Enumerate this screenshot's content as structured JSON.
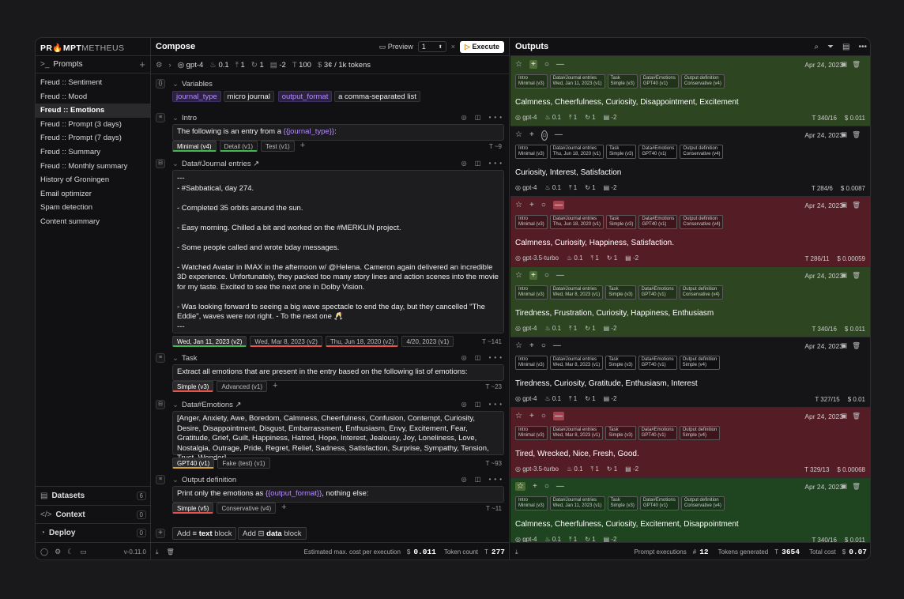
{
  "app": {
    "logo_bold": "PR🔥MPT",
    "logo_rest": "METHEUS",
    "version": "v-0.11.0"
  },
  "sidebar": {
    "header": "Prompts",
    "items": [
      "Freud :: Sentiment",
      "Freud :: Mood",
      "Freud :: Emotions",
      "Freud :: Prompt (3 days)",
      "Freud :: Prompt (7 days)",
      "Freud :: Summary",
      "Freud :: Monthly summary",
      "History of Groningen",
      "Email optimizer",
      "Spam detection",
      "Content summary"
    ],
    "active": "Freud :: Emotions",
    "sections": [
      {
        "label": "Datasets",
        "count": "6"
      },
      {
        "label": "Context",
        "count": "0"
      },
      {
        "label": "Deploy",
        "count": "0"
      }
    ]
  },
  "compose": {
    "title": "Compose",
    "preview": "Preview",
    "runs": "1",
    "execute": "Execute",
    "model": {
      "name": "gpt-4",
      "temperature": "0.1",
      "top_p": "1",
      "freq": "1",
      "presence": "-2",
      "max_tokens": "100",
      "cost": "3¢ / 1k tokens"
    },
    "variables_label": "Variables",
    "variables": [
      {
        "key": "journal_type",
        "value": "micro journal"
      },
      {
        "key": "output_format",
        "value": "a comma-separated list"
      }
    ],
    "intro": {
      "title": "Intro",
      "text_pre": "The following is an entry from a ",
      "var": "{{journal_type}}",
      "text_post": ":",
      "tabs": [
        "Minimal (v4)",
        "Detail (v1)",
        "Test (v1)"
      ],
      "tokens": "~9"
    },
    "journal": {
      "title": "Data#Journal entries",
      "lines": [
        "---",
        "- #Sabbatical, day 274.",
        "",
        "- Completed 35 orbits around the sun.",
        "",
        "- Easy morning. Chilled a bit and worked on the #MERKLIN project.",
        "",
        "- Some people called and wrote bday messages.",
        "",
        "- Watched Avatar in IMAX in the afternoon w/ @Helena. Cameron again delivered an incredible 3D experience. Unfortunately, they packed too many story lines and action scenes into the movie for my taste. Excited to see the next one in Dolby Vision.",
        "",
        "- Was looking forward to seeing a big wave spectacle to end the day, but they cancelled \"The Eddie\", waves were not right. - To the next one 🥂",
        "---"
      ],
      "tabs": [
        "Wed, Jan 11, 2023 (v2)",
        "Wed, Mar 8, 2023 (v2)",
        "Thu, Jun 18, 2020 (v2)",
        "4/20, 2023 (v1)"
      ],
      "tokens": "~141"
    },
    "task": {
      "title": "Task",
      "text": "Extract all emotions that are present in the entry based on the following list of emotions:",
      "tabs": [
        "Simple (v3)",
        "Advanced (v1)"
      ],
      "tokens": "~23"
    },
    "emotions": {
      "title": "Data#Emotions",
      "text": "[Anger, Anxiety, Awe, Boredom, Calmness, Cheerfulness, Confusion, Contempt, Curiosity, Desire, Disappointment, Disgust, Embarrassment, Enthusiasm, Envy, Excitement, Fear, Gratitude, Grief, Guilt, Happiness, Hatred, Hope, Interest, Jealousy, Joy, Loneliness, Love, Nostalgia, Outrage, Pride, Regret, Relief, Sadness, Satisfaction, Surprise, Sympathy, Tension, Trust, Wonder]",
      "tabs": [
        "GPT40 (v1)",
        "Fake (test) (v1)"
      ],
      "tokens": "~93"
    },
    "output_def": {
      "title": "Output definition",
      "text_pre": "Print only the emotions as ",
      "var": "{{output_format}}",
      "text_post": ", nothing else:",
      "tabs": [
        "Simple (v5)",
        "Conservative (v4)"
      ],
      "tokens": "~11"
    },
    "add_text": "Add",
    "add_text_b": "text",
    "add_block": "block",
    "add_data_b": "data",
    "footer": {
      "est_label": "Estimated max. cost per execution",
      "est": "0.011",
      "tok_label": "Token count",
      "tok": "277"
    }
  },
  "outputs": {
    "title": "Outputs",
    "cards": [
      {
        "state": "pos",
        "date": "Apr 24, 2023",
        "chips": [
          [
            "Intro",
            "Minimal (v3)"
          ],
          [
            "Data#Journal entries",
            "Wed, Jan 11, 2023 (v1)"
          ],
          [
            "Task",
            "Simple (v3)"
          ],
          [
            "Data#Emotions",
            "GPT40 (v1)"
          ],
          [
            "Output definition",
            "Conservative (v4)"
          ]
        ],
        "text": "Calmness, Cheerfulness, Curiosity, Disappointment, Excitement",
        "model": "gpt-4",
        "t": "0.1",
        "p": "1",
        "f": "1",
        "pr": "-2",
        "tokens": "340/16",
        "cost": "0.011"
      },
      {
        "state": "none",
        "date": "Apr 24, 2023",
        "chips": [
          [
            "Intro",
            "Minimal (v3)"
          ],
          [
            "Data#Journal entries",
            "Thu, Jun 18, 2020 (v1)"
          ],
          [
            "Task",
            "Simple (v3)"
          ],
          [
            "Data#Emotions",
            "GPT40 (v1)"
          ],
          [
            "Output definition",
            "Conservative (v4)"
          ]
        ],
        "text": "Curiosity, Interest, Satisfaction",
        "model": "gpt-4",
        "t": "0.1",
        "p": "1",
        "f": "1",
        "pr": "-2",
        "tokens": "284/6",
        "cost": "0.0087"
      },
      {
        "state": "neg",
        "date": "Apr 24, 2023",
        "chips": [
          [
            "Intro",
            "Minimal (v3)"
          ],
          [
            "Data#Journal entries",
            "Thu, Jun 18, 2020 (v1)"
          ],
          [
            "Task",
            "Simple (v3)"
          ],
          [
            "Data#Emotions",
            "GPT40 (v1)"
          ],
          [
            "Output definition",
            "Conservative (v4)"
          ]
        ],
        "text": "Calmness, Curiosity, Happiness, Satisfaction.",
        "model": "gpt-3.5-turbo",
        "t": "0.1",
        "p": "1",
        "f": "1",
        "pr": "-2",
        "tokens": "286/11",
        "cost": "0.00059"
      },
      {
        "state": "pos",
        "date": "Apr 24, 2023",
        "chips": [
          [
            "Intro",
            "Minimal (v3)"
          ],
          [
            "Data#Journal entries",
            "Wed, Mar 8, 2023 (v1)"
          ],
          [
            "Task",
            "Simple (v3)"
          ],
          [
            "Data#Emotions",
            "GPT40 (v1)"
          ],
          [
            "Output definition",
            "Conservative (v4)"
          ]
        ],
        "text": "Tiredness, Frustration, Curiosity, Happiness, Enthusiasm",
        "model": "gpt-4",
        "t": "0.1",
        "p": "1",
        "f": "1",
        "pr": "-2",
        "tokens": "340/16",
        "cost": "0.011"
      },
      {
        "state": "none",
        "date": "Apr 24, 2023",
        "chips": [
          [
            "Intro",
            "Minimal (v3)"
          ],
          [
            "Data#Journal entries",
            "Wed, Mar 8, 2023 (v1)"
          ],
          [
            "Task",
            "Simple (v3)"
          ],
          [
            "Data#Emotions",
            "GPT40 (v1)"
          ],
          [
            "Output definition",
            "Simple (v4)"
          ]
        ],
        "text": "Tiredness, Curiosity, Gratitude, Enthusiasm, Interest",
        "model": "gpt-4",
        "t": "0.1",
        "p": "1",
        "f": "1",
        "pr": "-2",
        "tokens": "327/15",
        "cost": "0.01"
      },
      {
        "state": "neg",
        "date": "Apr 24, 2023",
        "chips": [
          [
            "Intro",
            "Minimal (v3)"
          ],
          [
            "Data#Journal entries",
            "Wed, Mar 8, 2023 (v1)"
          ],
          [
            "Task",
            "Simple (v3)"
          ],
          [
            "Data#Emotions",
            "GPT40 (v1)"
          ],
          [
            "Output definition",
            "Simple (v4)"
          ]
        ],
        "text": "Tired, Wrecked, Nice, Fresh, Good.",
        "model": "gpt-3.5-turbo",
        "t": "0.1",
        "p": "1",
        "f": "1",
        "pr": "-2",
        "tokens": "329/13",
        "cost": "0.00068"
      },
      {
        "state": "pos2",
        "date": "Apr 24, 2023",
        "chips": [
          [
            "Intro",
            "Minimal (v3)"
          ],
          [
            "Data#Journal entries",
            "Wed, Jan 11, 2023 (v1)"
          ],
          [
            "Task",
            "Simple (v3)"
          ],
          [
            "Data#Emotions",
            "GPT40 (v1)"
          ],
          [
            "Output definition",
            "Conservative (v4)"
          ]
        ],
        "text": "Calmness, Cheerfulness, Curiosity, Excitement, Disappointment",
        "model": "gpt-4",
        "t": "0.1",
        "p": "1",
        "f": "1",
        "pr": "-2",
        "tokens": "340/16",
        "cost": "0.011"
      }
    ],
    "footer": {
      "exec_label": "Prompt executions",
      "exec": "12",
      "gen_label": "Tokens generated",
      "gen": "3654",
      "cost_label": "Total cost",
      "cost": "0.07"
    }
  }
}
